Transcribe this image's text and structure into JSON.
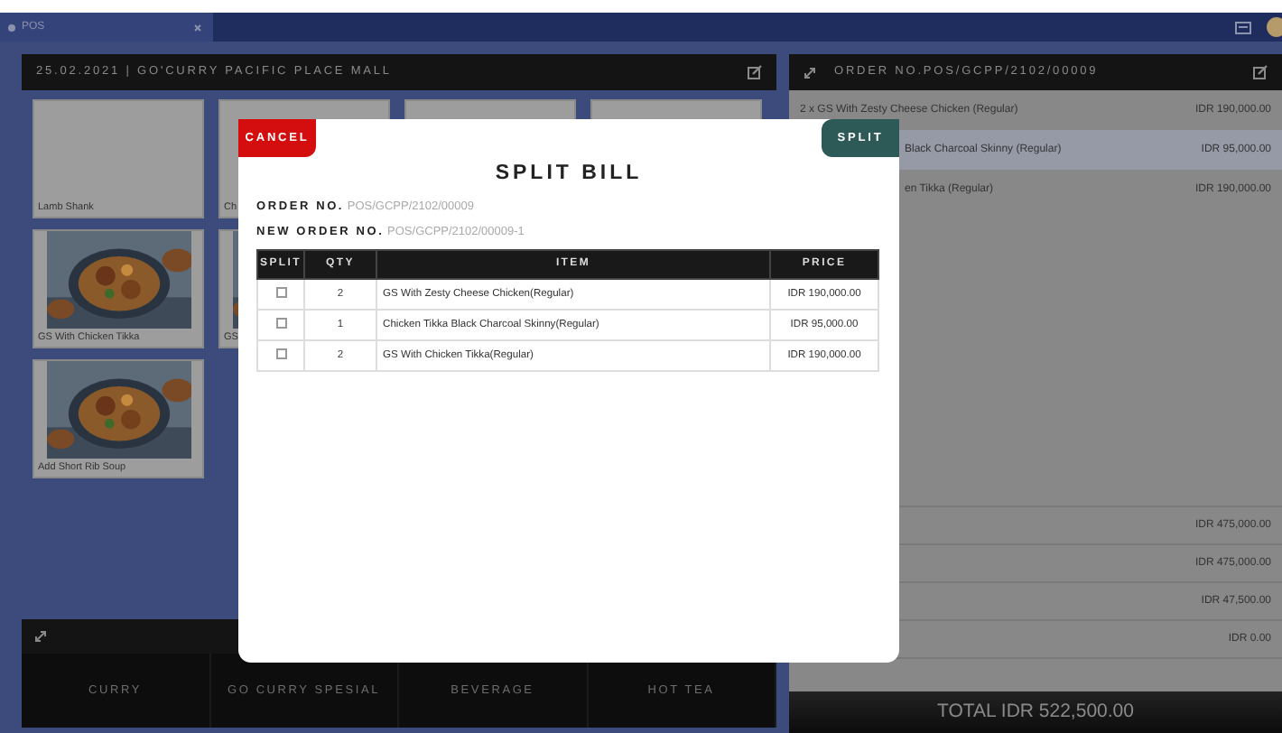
{
  "window": {
    "tab": "POS"
  },
  "menu": {
    "header": "25.02.2021 | GO'CURRY PACIFIC PLACE MALL",
    "tile_rows": [
      [
        {
          "label": "Lamb Shank",
          "kind": "plain"
        },
        {
          "label": "Ch",
          "kind": "plain"
        },
        {
          "kind": "plain"
        },
        {
          "kind": "plain"
        }
      ],
      [
        {
          "label": "GS With Chicken Tikka",
          "kind": "picture"
        },
        {
          "label": "GS",
          "kind": "picture"
        }
      ],
      [
        {
          "label": "Add Short Rib Soup",
          "kind": "picture"
        }
      ]
    ],
    "categories": [
      "CURRY",
      "GO CURRY SPESIAL",
      "BEVERAGE",
      "HOT TEA"
    ]
  },
  "order": {
    "title": "ORDER NO.POS/GCPP/2102/00009",
    "items": [
      {
        "name": "2 x GS With Zesty Cheese Chicken (Regular)",
        "price": "IDR 190,000.00",
        "kind": "full",
        "selected": false
      },
      {
        "name": "Black Charcoal Skinny (Regular)",
        "price": "IDR 95,000.00",
        "kind": "covered",
        "selected": true
      },
      {
        "name": "en Tikka (Regular)",
        "price": "IDR 190,000.00",
        "kind": "covered",
        "selected": false
      }
    ],
    "summary": [
      "IDR 475,000.00",
      "IDR 475,000.00",
      "IDR 47,500.00",
      "IDR 0.00"
    ],
    "total": "TOTAL IDR 522,500.00"
  },
  "dialog": {
    "cancel": "CANCEL",
    "confirm": "SPLIT",
    "title": "SPLIT BILL",
    "order_no": {
      "label": "ORDER NO.",
      "value": "POS/GCPP/2102/00009"
    },
    "new_order_no": {
      "label": "NEW ORDER NO.",
      "value": "POS/GCPP/2102/00009-1"
    },
    "columns": [
      "SPLIT",
      "QTY",
      "ITEM",
      "PRICE"
    ],
    "rows": [
      {
        "checked": false,
        "qty": "2",
        "item": "GS With Zesty Cheese Chicken(Regular)",
        "price": "IDR 190,000.00"
      },
      {
        "checked": false,
        "qty": "1",
        "item": "Chicken Tikka Black Charcoal Skinny(Regular)",
        "price": "IDR 95,000.00"
      },
      {
        "checked": false,
        "qty": "2",
        "item": "GS With Chicken Tikka(Regular)",
        "price": "IDR 190,000.00"
      }
    ]
  }
}
